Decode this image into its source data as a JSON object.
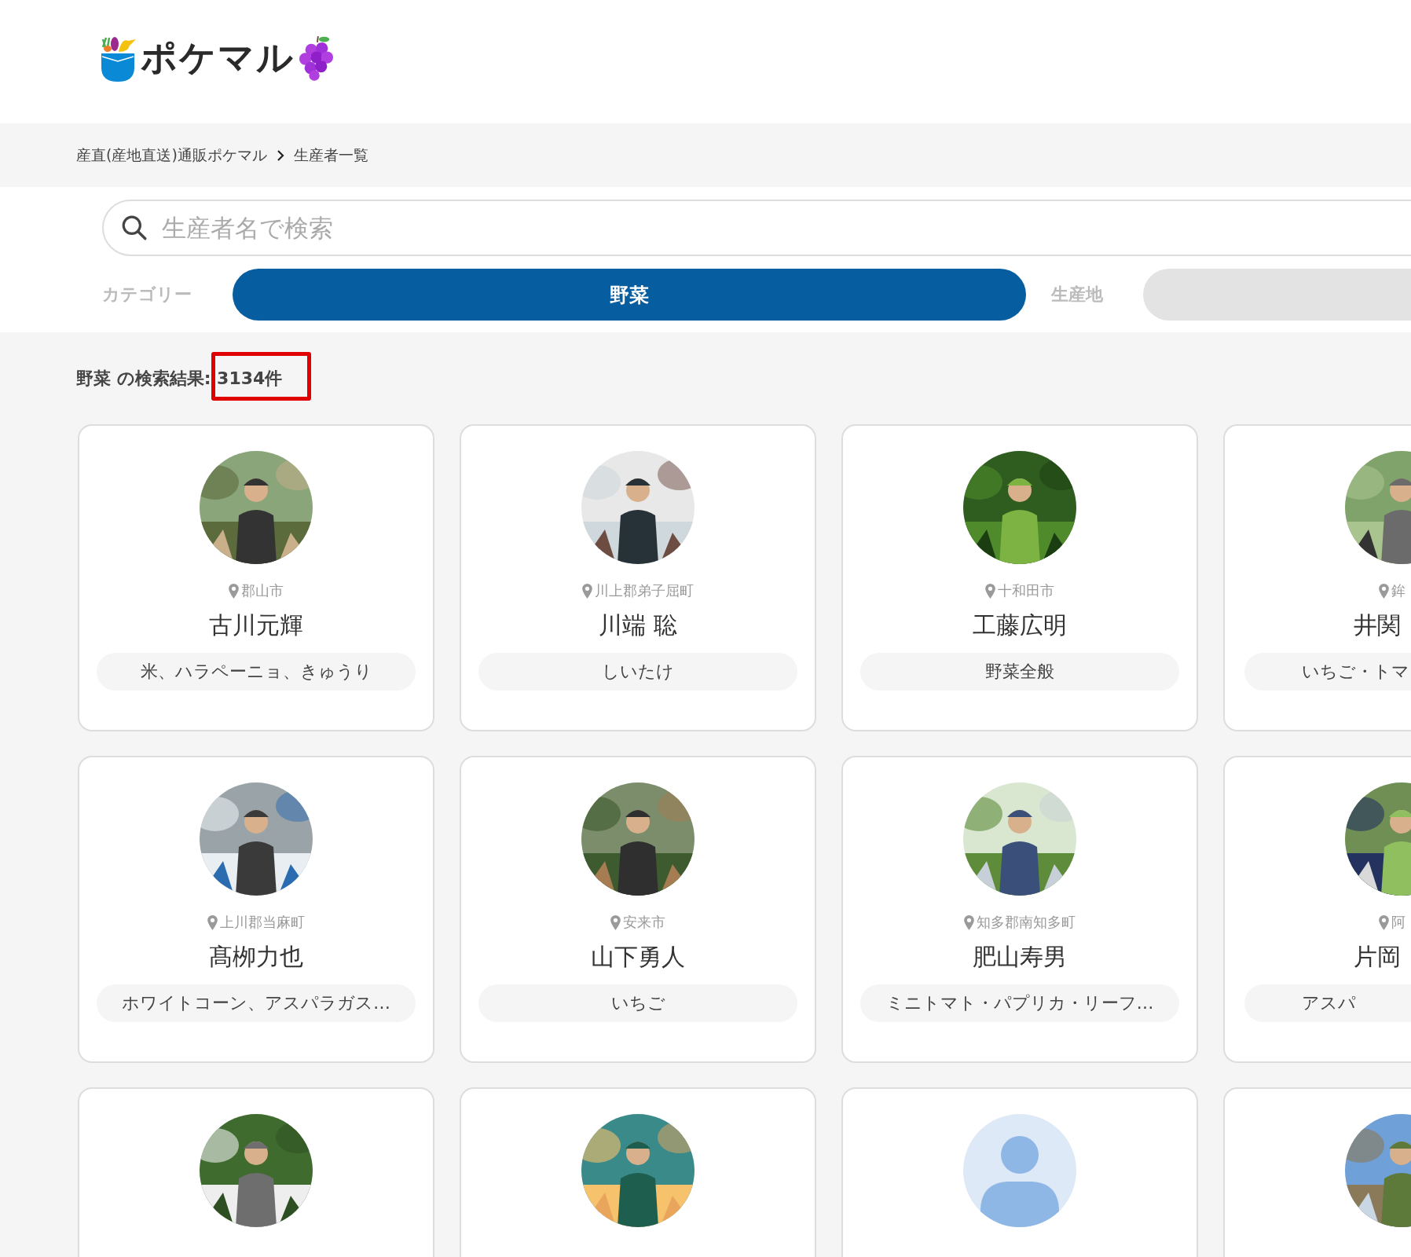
{
  "logo": {
    "text": "ポケマル"
  },
  "breadcrumb": [
    {
      "label": "産直(産地直送)通販ポケマル"
    },
    {
      "label": "生産者一覧"
    }
  ],
  "search": {
    "placeholder": "生産者名で検索"
  },
  "filters": [
    {
      "label": "カテゴリー",
      "value": "野菜"
    },
    {
      "label": "生産地"
    }
  ],
  "results": {
    "query": "野菜",
    "text": "の検索結果",
    "count": ": 3134件",
    "highlighted": true
  },
  "producers": [
    {
      "kind": "picture",
      "location": "郡山市",
      "name": "古川元輝",
      "tags": "米、ハラペーニョ、きゅうり"
    },
    {
      "kind": "picture",
      "location": "川上郡弟子屈町",
      "name": "川端 聡",
      "tags": "しいたけ"
    },
    {
      "kind": "picture",
      "location": "十和田市",
      "name": "工藤広明",
      "tags": "野菜全般"
    },
    {
      "kind": "picture",
      "location": "鉾",
      "name": "井関",
      "tags": "いちご・トマ"
    },
    {
      "kind": "picture",
      "location": "上川郡当麻町",
      "name": "髙栁力也",
      "tags": "ホワイトコーン、アスパラガス…"
    },
    {
      "kind": "picture",
      "location": "安来市",
      "name": "山下勇人",
      "tags": "いちご"
    },
    {
      "kind": "picture",
      "location": "知多郡南知多町",
      "name": "肥山寿男",
      "tags": "ミニトマト・パプリカ・リーフ…"
    },
    {
      "kind": "picture",
      "location": "阿",
      "name": "片岡",
      "tags": "アスパ"
    },
    {
      "kind": "picture"
    },
    {
      "kind": "picture"
    },
    {
      "kind": "default"
    },
    {
      "kind": "picture"
    }
  ]
}
